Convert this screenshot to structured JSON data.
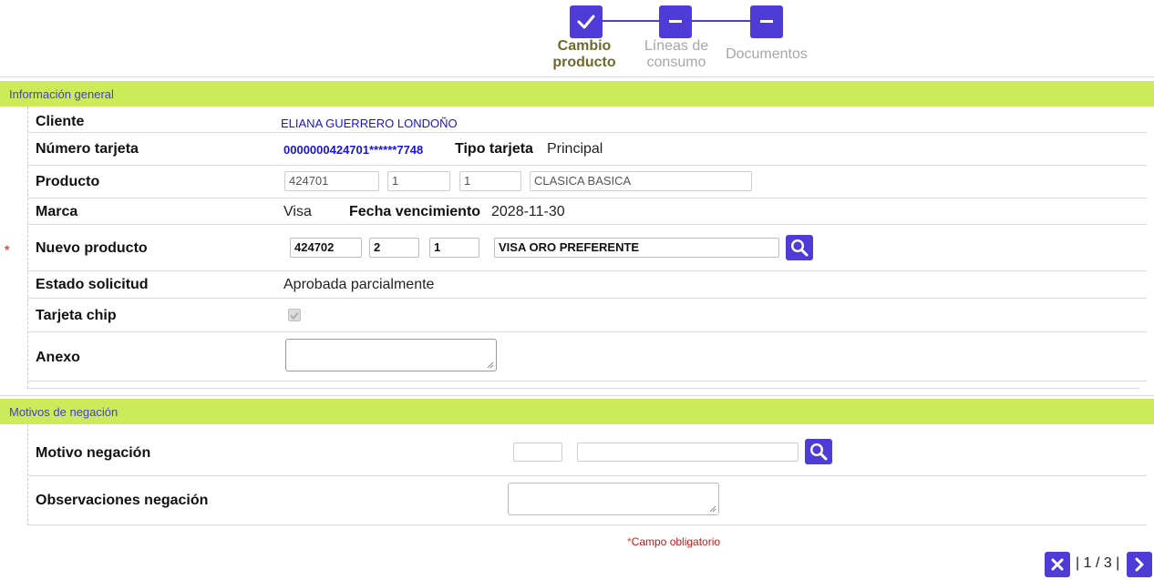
{
  "stepper": {
    "steps": [
      {
        "label_1": "Cambio",
        "label_2": "producto",
        "state": "done"
      },
      {
        "label_1": "Líneas de",
        "label_2": "consumo",
        "state": "pending"
      },
      {
        "label": "Documentos",
        "state": "pending"
      }
    ]
  },
  "general": {
    "section_title": "Información general",
    "cliente": {
      "label": "Cliente",
      "value": "ELIANA GUERRERO LONDOÑO"
    },
    "numero_tarjeta": {
      "label": "Número tarjeta",
      "value": "0000000424701******7748"
    },
    "tipo_tarjeta": {
      "label": "Tipo tarjeta",
      "value": "Principal"
    },
    "producto": {
      "label": "Producto",
      "code": "424701",
      "f2": "1",
      "f3": "1",
      "name": "CLASICA BASICA"
    },
    "marca": {
      "label": "Marca",
      "value": "Visa"
    },
    "fecha_vencimiento": {
      "label": "Fecha vencimiento",
      "value": "2028-11-30"
    },
    "nuevo_producto": {
      "label": "Nuevo producto",
      "required_mark": "*",
      "code": "424702",
      "f2": "2",
      "f3": "1",
      "name": "VISA ORO PREFERENTE"
    },
    "estado_solicitud": {
      "label": "Estado solicitud",
      "value": "Aprobada parcialmente"
    },
    "tarjeta_chip": {
      "label": "Tarjeta chip",
      "checked": true
    },
    "anexo": {
      "label": "Anexo",
      "value": ""
    }
  },
  "negacion": {
    "section_title": "Motivos de negación",
    "motivo": {
      "label": "Motivo negación",
      "code": "",
      "description": ""
    },
    "observaciones": {
      "label": "Observaciones negación",
      "value": ""
    }
  },
  "footer": {
    "required_star": "*",
    "required_note": "Campo obligatorio",
    "pager_text": "| 1 / 3 |"
  },
  "colors": {
    "accent": "#4f3bd6",
    "section_bar": "#cdea5a",
    "section_text": "#4a3ec4",
    "link_blue": "#1a14cc",
    "required": "#e8482f"
  }
}
